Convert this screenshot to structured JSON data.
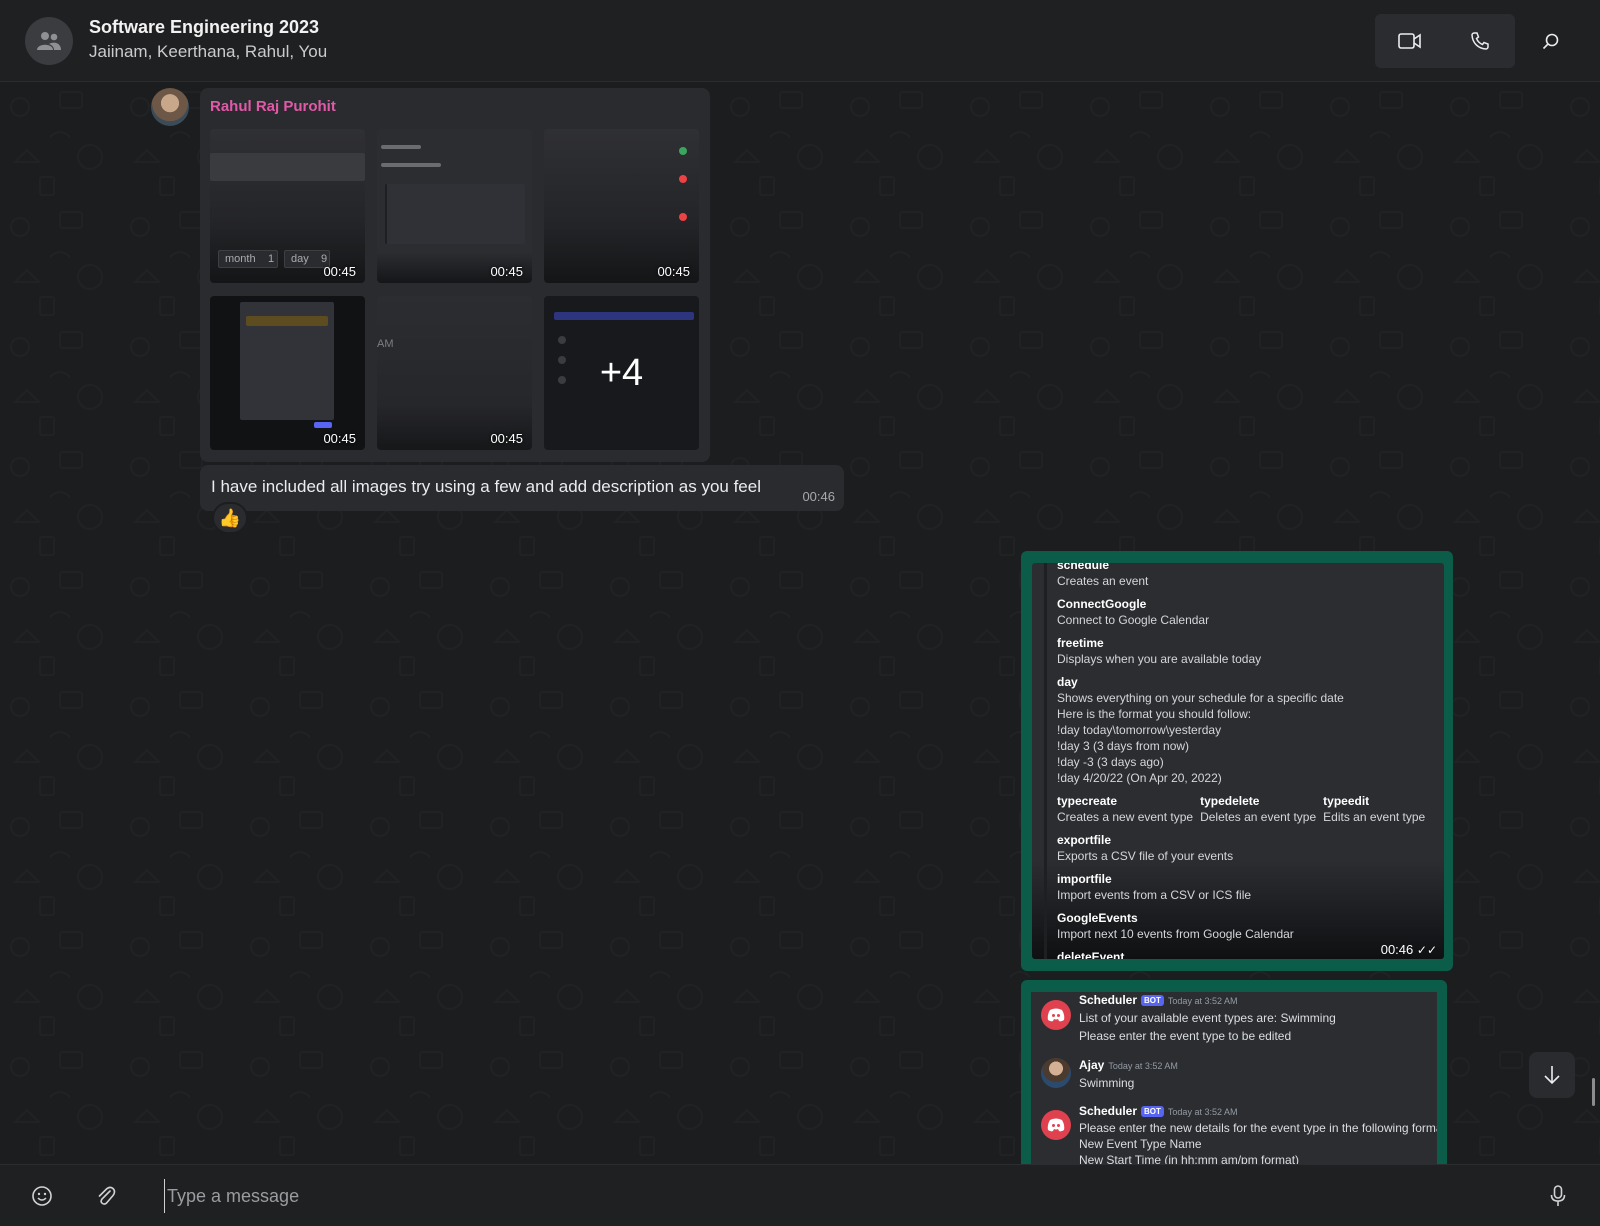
{
  "header": {
    "title": "Software Engineering 2023",
    "participants": "Jaiinam, Keerthana, Rahul, You",
    "icons": [
      "group-avatar-icon",
      "video-call-icon",
      "voice-call-icon",
      "search-icon"
    ]
  },
  "incoming": {
    "sender": "Rahul Raj Purohit",
    "thumbnails": [
      {
        "duration": "00:45",
        "overlay_labels": [
          "month",
          "1",
          "day",
          "9"
        ]
      },
      {
        "duration": "00:45",
        "overlay_labels": []
      },
      {
        "duration": "00:45",
        "overlay_labels": []
      },
      {
        "duration": "00:45",
        "overlay_labels": []
      },
      {
        "duration": "00:45",
        "overlay_labels": [
          "AM"
        ]
      },
      {
        "duration": "",
        "overlay_labels": []
      }
    ],
    "more_count": "+4",
    "text": "I have included all images try using a few and add description as you feel",
    "text_time": "00:46",
    "reaction": "👍"
  },
  "outgoing": {
    "image1": {
      "time": "00:46",
      "status": "read",
      "commands": [
        {
          "name": "schedule",
          "desc": "Creates an event"
        },
        {
          "name": "ConnectGoogle",
          "desc": "Connect to Google Calendar"
        },
        {
          "name": "freetime",
          "desc": "Displays when you are available today"
        },
        {
          "name": "day",
          "desc": "Shows everything on your schedule for a specific date",
          "extra": [
            "Here is the format you should follow:",
            "!day today\\tomorrow\\yesterday",
            "!day 3 (3 days from now)",
            "!day -3 (3 days ago)",
            "!day 4/20/22 (On Apr 20, 2022)"
          ]
        },
        {
          "name": "exportfile",
          "desc": "Exports a CSV file of your events"
        },
        {
          "name": "importfile",
          "desc": "Import events from a CSV or ICS file"
        },
        {
          "name": "GoogleEvents",
          "desc": "Import next 10 events from Google Calendar"
        },
        {
          "name": "deleteEvent",
          "desc": ""
        }
      ],
      "type_commands": [
        {
          "name": "typecreate",
          "desc": "Creates a new event type"
        },
        {
          "name": "typedelete",
          "desc": "Deletes an event type"
        },
        {
          "name": "typeedit",
          "desc": "Edits an event type"
        }
      ]
    },
    "image2": {
      "messages": [
        {
          "author": "Scheduler",
          "bot": "BOT",
          "stamp": "Today at 3:52 AM",
          "lines": [
            "List of your available event types are: Swimming",
            "Please enter the event type to be edited"
          ]
        },
        {
          "author": "Ajay",
          "bot": "",
          "stamp": "Today at 3:52 AM",
          "lines": [
            "Swimming"
          ]
        },
        {
          "author": "Scheduler",
          "bot": "BOT",
          "stamp": "Today at 3:52 AM",
          "lines": [
            "Please enter the new details for the event type in the following format:",
            "New Event Type Name",
            "New Start Time (in hh:mm am/pm format)"
          ]
        }
      ]
    }
  },
  "composer": {
    "placeholder": "Type a message",
    "icons": [
      "emoji-icon",
      "attach-icon",
      "microphone-icon"
    ]
  },
  "colors": {
    "accent_outgoing": "#0b5c48",
    "sender_name": "#e15aa8",
    "background": "#1c1d1f"
  }
}
